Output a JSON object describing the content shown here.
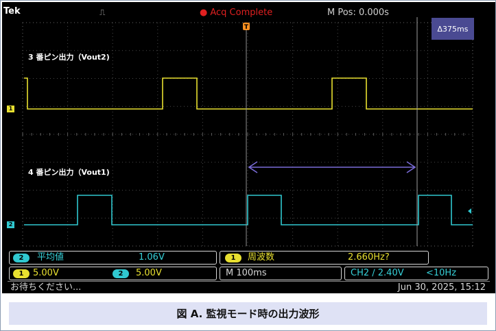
{
  "header": {
    "brand": "Tek",
    "trigger_icon": "pulse-icon",
    "acq_status": "Acq Complete",
    "mpos": "M Pos: 0.000s"
  },
  "cursor": {
    "delta_label": "Δ375ms"
  },
  "channels": {
    "ch1": {
      "marker": "1",
      "title": "3 番ピン出力（Vout2)",
      "color": "#e8e030"
    },
    "ch2": {
      "marker": "2",
      "title": "4 番ピン出力（Vout1)",
      "color": "#30c8d0"
    }
  },
  "measurements": {
    "row1": {
      "m1_pill": "2",
      "m1_name": "平均値",
      "m1_value": "1.06V",
      "m2_pill": "1",
      "m2_name": "周波数",
      "m2_value": "2.660Hz?"
    },
    "row2": {
      "ch1_pill": "1",
      "ch1_scale": "5.00V",
      "ch2_pill": "2",
      "ch2_scale": "5.00V",
      "timebase": "M 100ms",
      "trigger": "CH2 ∕ 2.40V",
      "trigger_freq": "<10Hz"
    }
  },
  "message": {
    "left": "お待ちください...",
    "right": "Jun 30, 2025, 15:12"
  },
  "caption": "図 A. 監視モード時の出力波形"
}
